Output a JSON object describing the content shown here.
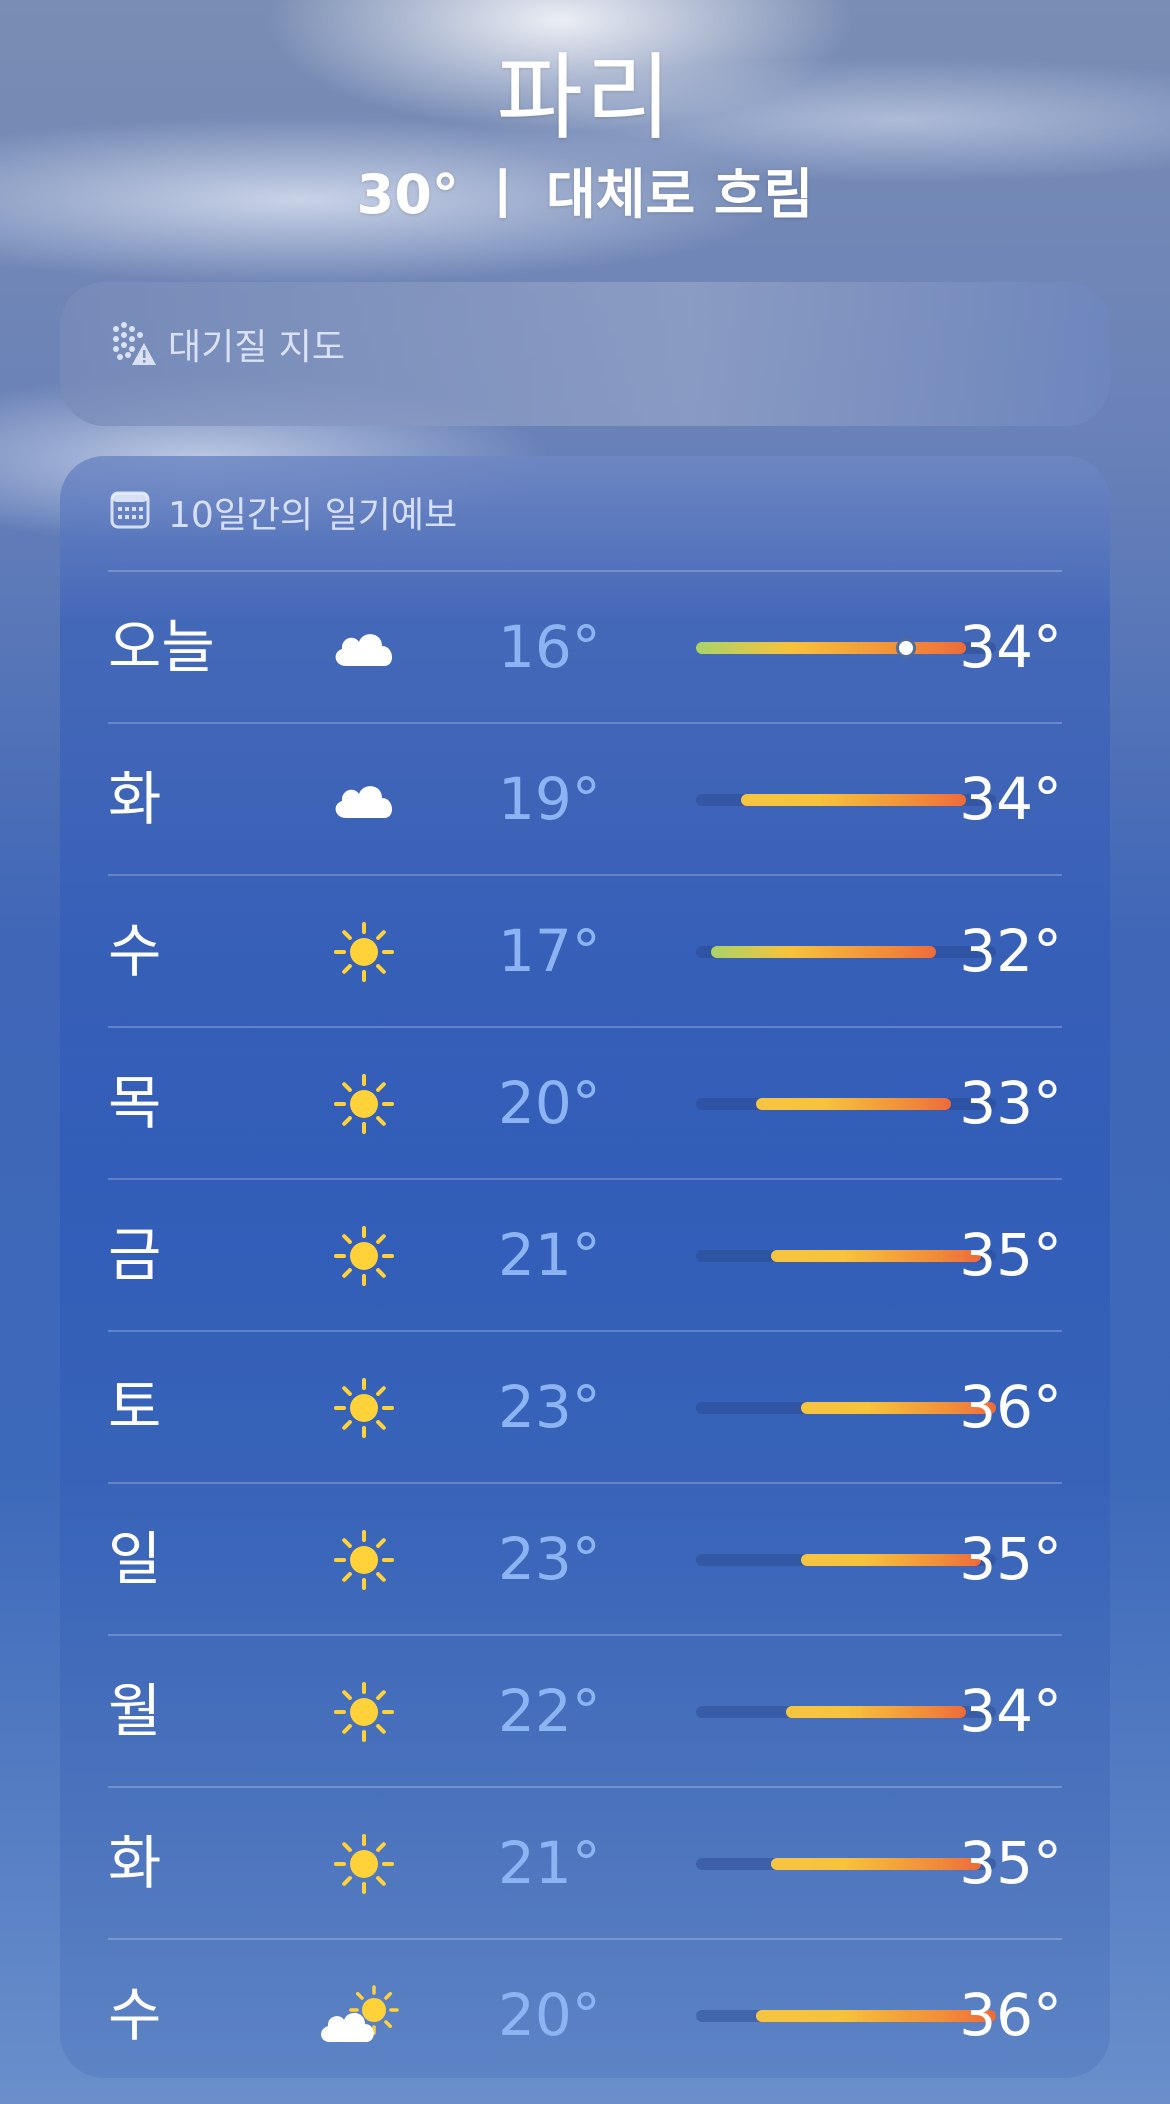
{
  "location": {
    "city": "파리",
    "summary": "30° ㅣ 대체로 흐림"
  },
  "air_quality": {
    "title": "대기질 지도",
    "icon": "air-quality-map-icon"
  },
  "forecast": {
    "title": "10일간의 일기예보",
    "icon": "calendar-icon",
    "current_temp": 30,
    "days": [
      {
        "day": "오늘",
        "icon": "cloud",
        "low": "16°",
        "high": "34°",
        "low_val": 16,
        "high_val": 34,
        "current": true
      },
      {
        "day": "화",
        "icon": "cloud",
        "low": "19°",
        "high": "34°",
        "low_val": 19,
        "high_val": 34
      },
      {
        "day": "수",
        "icon": "sun",
        "low": "17°",
        "high": "32°",
        "low_val": 17,
        "high_val": 32
      },
      {
        "day": "목",
        "icon": "sun",
        "low": "20°",
        "high": "33°",
        "low_val": 20,
        "high_val": 33
      },
      {
        "day": "금",
        "icon": "sun",
        "low": "21°",
        "high": "35°",
        "low_val": 21,
        "high_val": 35
      },
      {
        "day": "토",
        "icon": "sun",
        "low": "23°",
        "high": "36°",
        "low_val": 23,
        "high_val": 36
      },
      {
        "day": "일",
        "icon": "sun",
        "low": "23°",
        "high": "35°",
        "low_val": 23,
        "high_val": 35
      },
      {
        "day": "월",
        "icon": "sun",
        "low": "22°",
        "high": "34°",
        "low_val": 22,
        "high_val": 34
      },
      {
        "day": "화",
        "icon": "sun",
        "low": "21°",
        "high": "35°",
        "low_val": 21,
        "high_val": 35
      },
      {
        "day": "수",
        "icon": "partly-sunny",
        "low": "20°",
        "high": "36°",
        "low_val": 20,
        "high_val": 36
      }
    ]
  },
  "colors": {
    "low_temp": "#8db4f2",
    "sun": "#ffd23a"
  }
}
